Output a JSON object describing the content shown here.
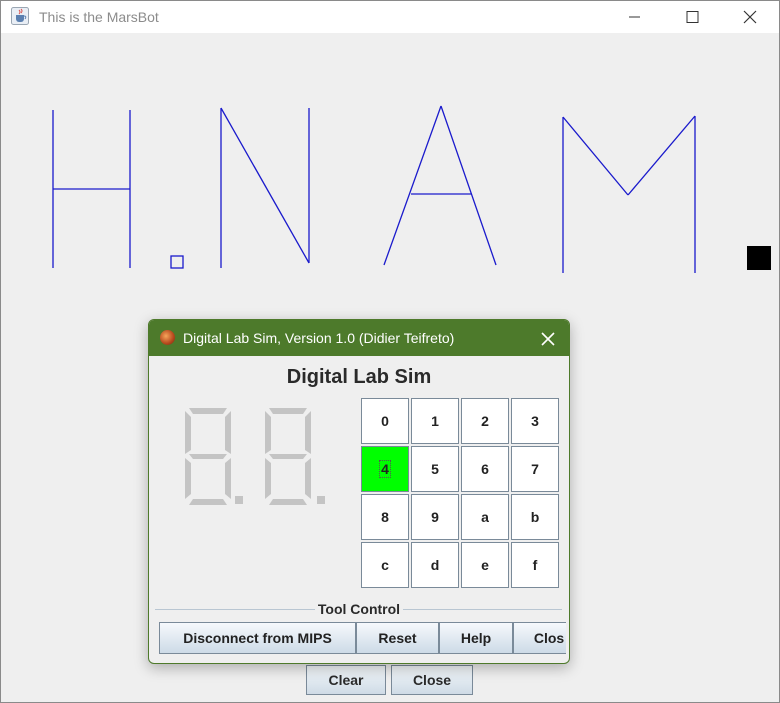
{
  "window": {
    "title": "This is the MarsBot",
    "icon": "java-cup-icon",
    "controls": [
      "minimize-icon",
      "maximize-icon",
      "close-icon"
    ]
  },
  "canvas": {
    "drawing_color": "#1a1acc",
    "marker_color": "#000000"
  },
  "bottom_buttons": {
    "clear": "Clear",
    "close": "Close"
  },
  "dialog": {
    "title": "Digital Lab Sim,  Version 1.0 (Didier Teifreto)",
    "icon": "mars-planet-icon",
    "title_bar_color": "#4d7a2b",
    "heading": "Digital Lab Sim",
    "display": {
      "left_digit": "8.",
      "right_digit": "8.",
      "lit": false
    },
    "keypad": {
      "keys": [
        "0",
        "1",
        "2",
        "3",
        "4",
        "5",
        "6",
        "7",
        "8",
        "9",
        "a",
        "b",
        "c",
        "d",
        "e",
        "f"
      ],
      "active_key": "4",
      "active_color": "#00ff00"
    },
    "tool_control": {
      "label": "Tool Control",
      "buttons": [
        "Disconnect from MIPS",
        "Reset",
        "Help",
        "Clos"
      ]
    }
  }
}
